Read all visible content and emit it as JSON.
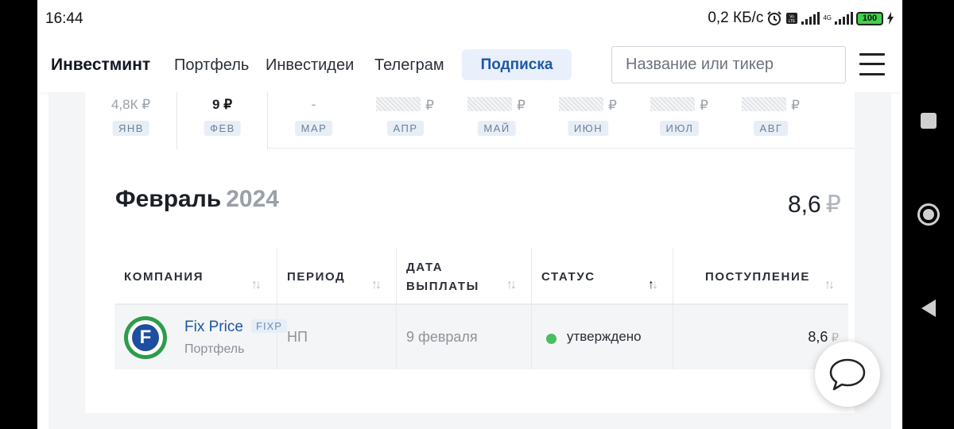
{
  "status_bar": {
    "time": "16:44",
    "speed": "0,2 КБ/с",
    "net_4g": "4G",
    "battery": "100"
  },
  "header": {
    "logo": "Инвестминт",
    "nav": [
      "Портфель",
      "Инвестидеи",
      "Телеграм"
    ],
    "subscribe_label": "Подписка",
    "search_placeholder": "Название или тикер"
  },
  "months": [
    {
      "value": "4,8К",
      "currency": "₽",
      "label": "ЯНВ",
      "hidden": false
    },
    {
      "value": "9",
      "currency": "₽",
      "label": "ФЕВ",
      "hidden": false,
      "active": true
    },
    {
      "value": "-",
      "currency": "",
      "label": "МАР",
      "hidden": false
    },
    {
      "value": "",
      "currency": "₽",
      "label": "АПР",
      "hidden": true
    },
    {
      "value": "",
      "currency": "₽",
      "label": "МАЙ",
      "hidden": true
    },
    {
      "value": "",
      "currency": "₽",
      "label": "ИЮН",
      "hidden": true
    },
    {
      "value": "",
      "currency": "₽",
      "label": "ИЮЛ",
      "hidden": true
    },
    {
      "value": "",
      "currency": "₽",
      "label": "АВГ",
      "hidden": true
    }
  ],
  "detail": {
    "month": "Февраль",
    "year": "2024",
    "total": "8,6",
    "currency": "₽"
  },
  "table": {
    "columns": {
      "company": "КОМПАНИЯ",
      "period": "ПЕРИОД",
      "date_line1": "ДАТА",
      "date_line2": "ВЫПЛАТЫ",
      "status": "СТАТУС",
      "income": "ПОСТУПЛЕНИЕ"
    },
    "sort_icon": "↑↓",
    "rows": [
      {
        "company": "Fix Price",
        "ticker": "FIXP",
        "source": "Портфель",
        "logo_letter": "F",
        "period": "НП",
        "date": "9 февраля",
        "status": "утверждено",
        "amount": "8,6",
        "currency": "₽"
      }
    ]
  },
  "colors": {
    "accent": "#1d58a8",
    "status_ok": "#4bbd61",
    "logo_green": "#2e9c4b",
    "logo_blue": "#1d4ea0"
  }
}
